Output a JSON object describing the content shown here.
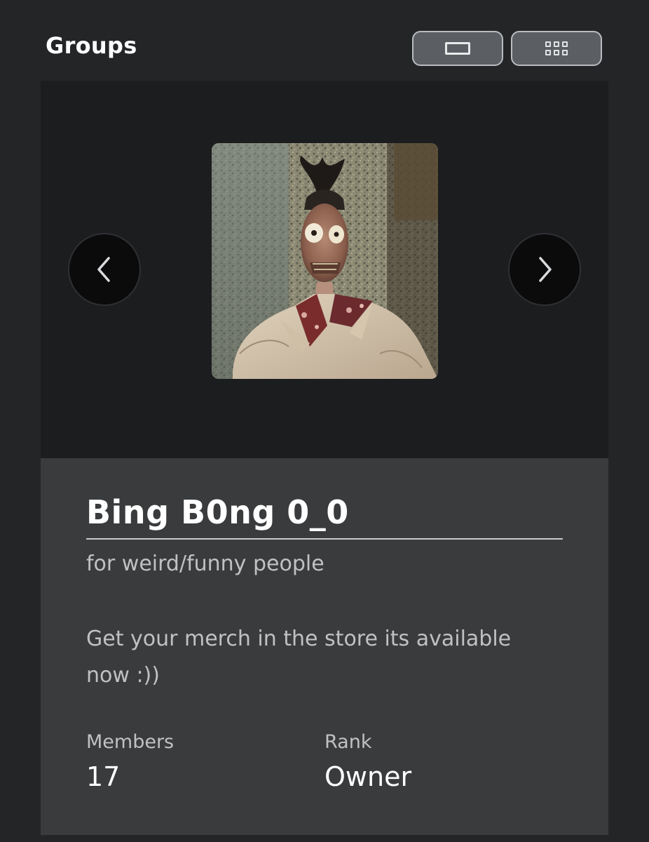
{
  "header": {
    "title": "Groups"
  },
  "view_toggle": {
    "single_icon": "single-view-icon",
    "grid_icon": "grid-view-icon"
  },
  "carousel": {
    "prev_icon": "chevron-left-icon",
    "next_icon": "chevron-right-icon"
  },
  "group": {
    "name": "Bing B0ng 0_0",
    "tagline": "for weird/funny people",
    "description": "Get your merch in the store its available now :))",
    "members_label": "Members",
    "members_value": "17",
    "rank_label": "Rank",
    "rank_value": "Owner"
  },
  "colors": {
    "page_background": "#232527",
    "carousel_background": "#1c1d1f",
    "info_background": "#393b3d",
    "secondary_text": "#bfc1c3"
  }
}
